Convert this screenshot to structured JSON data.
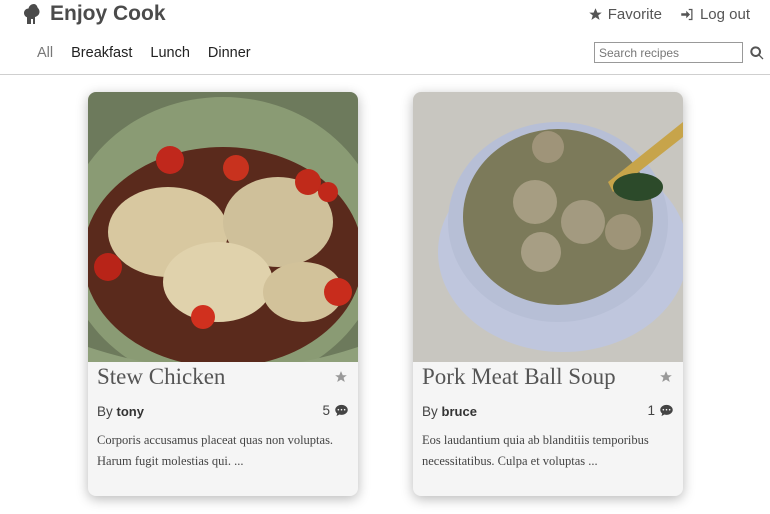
{
  "brand": {
    "title": "Enjoy Cook",
    "logo_icon": "chef-hat-icon"
  },
  "topnav": {
    "favorite_label": "Favorite",
    "logout_label": "Log out"
  },
  "categories": [
    "All",
    "Breakfast",
    "Lunch",
    "Dinner"
  ],
  "search": {
    "placeholder": "Search recipes"
  },
  "recipes": [
    {
      "title": "Stew Chicken",
      "by_label": "By",
      "author": "tony",
      "comments": "5",
      "description": "Corporis accusamus placeat quas non voluptas. Harum fugit molestias qui. ..."
    },
    {
      "title": "Pork Meat Ball Soup",
      "by_label": "By",
      "author": "bruce",
      "comments": "1",
      "description": "Eos laudantium quia ab blanditiis temporibus necessitatibus. Culpa et voluptas ..."
    }
  ],
  "colors": {
    "card_bg": "#f5f5f5",
    "divider": "#cfcfcf",
    "text": "#444444"
  }
}
